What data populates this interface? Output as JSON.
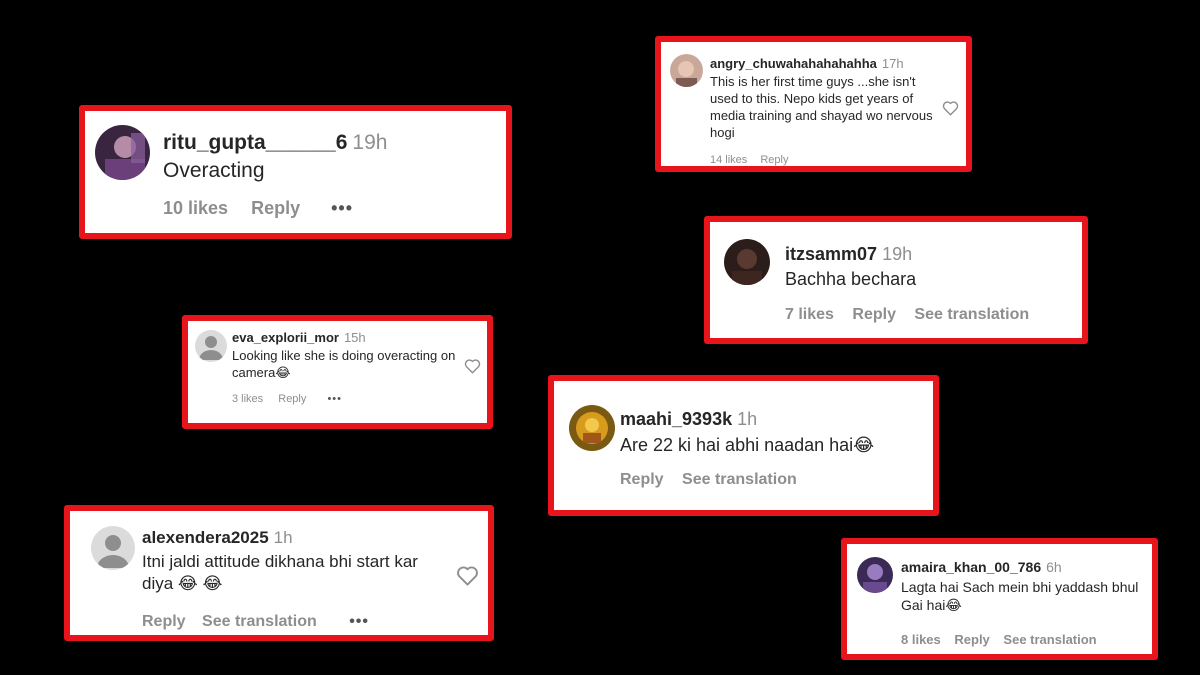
{
  "comments": [
    {
      "username": "ritu_gupta______6",
      "time": "19h",
      "text": "Overacting",
      "likes": "10 likes",
      "reply": "Reply",
      "more": "•••"
    },
    {
      "username": "angry_chuwahahahahahha",
      "time": "17h",
      "text": "This is her first time guys ...she isn't used to this. Nepo kids get years of media training and shayad wo nervous hogi",
      "likes": "14 likes",
      "reply": "Reply"
    },
    {
      "username": "itzsamm07",
      "time": "19h",
      "text": "Bachha bechara",
      "likes": "7 likes",
      "reply": "Reply",
      "translation": "See translation"
    },
    {
      "username": "eva_explorii_mor",
      "time": "15h",
      "text": "Looking like she is doing overacting on camera😂",
      "likes": "3 likes",
      "reply": "Reply",
      "more": "•••"
    },
    {
      "username": "maahi_9393k",
      "time": "1h",
      "text": "Are 22 ki hai abhi naadan hai😂",
      "reply": "Reply",
      "translation": "See translation"
    },
    {
      "username": "alexendera2025",
      "time": "1h",
      "text": "Itni jaldi attitude dikhana bhi start kar diya 😂 😂",
      "reply": "Reply",
      "translation": "See translation",
      "more": "•••"
    },
    {
      "username": "amaira_khan_00_786",
      "time": "6h",
      "text": "Lagta hai Sach mein bhi yaddash bhul Gai hai😂",
      "likes": "8 likes",
      "reply": "Reply",
      "translation": "See translation"
    }
  ],
  "colors": {
    "border": "#e8141b",
    "username": "#262626",
    "muted": "#8e8e8e",
    "background": "#000000"
  }
}
